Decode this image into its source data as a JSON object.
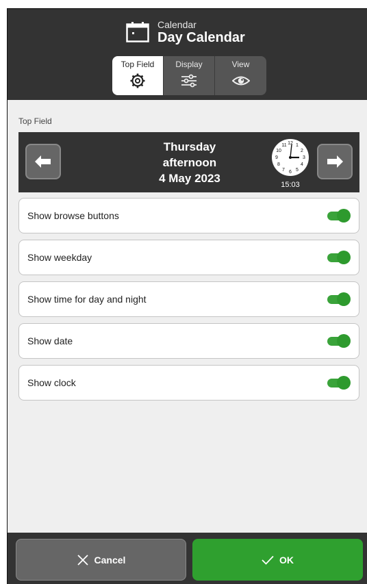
{
  "header": {
    "subtitle": "Calendar",
    "title": "Day Calendar"
  },
  "tabs": [
    {
      "label": "Top Field",
      "icon": "gear-icon",
      "active": true
    },
    {
      "label": "Display",
      "icon": "sliders-icon",
      "active": false
    },
    {
      "label": "View",
      "icon": "eye-icon",
      "active": false
    }
  ],
  "section_label": "Top Field",
  "preview": {
    "weekday": "Thursday",
    "time_of_day": "afternoon",
    "date": "4 May 2023",
    "clock_time": "15:03"
  },
  "options": [
    {
      "label": "Show browse buttons",
      "enabled": true
    },
    {
      "label": "Show weekday",
      "enabled": true
    },
    {
      "label": "Show time for day and night",
      "enabled": true
    },
    {
      "label": "Show date",
      "enabled": true
    },
    {
      "label": "Show clock",
      "enabled": true
    }
  ],
  "footer": {
    "cancel_label": "Cancel",
    "ok_label": "OK"
  },
  "colors": {
    "header_bg": "#333333",
    "toggle_on": "#2e9a2e",
    "ok_button": "#2fa02f",
    "cancel_button": "#666666"
  }
}
